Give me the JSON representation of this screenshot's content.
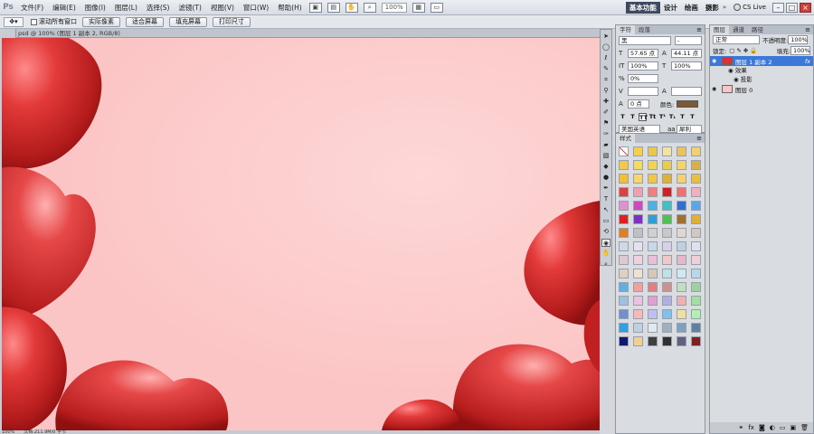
{
  "app": {
    "logo": "Ps"
  },
  "menu": [
    "文件(F)",
    "编辑(E)",
    "图像(I)",
    "图层(L)",
    "选择(S)",
    "滤镜(T)",
    "视图(V)",
    "窗口(W)",
    "帮助(H)"
  ],
  "appbar": {
    "zoom": "100%"
  },
  "workspaces": {
    "active": "基本功能",
    "items": [
      "设计",
      "绘画",
      "摄影"
    ],
    "more": "»"
  },
  "cs_live": "CS Live",
  "options": {
    "scroll_all_label": "滚动所有窗口",
    "buttons": [
      "实际像素",
      "适合屏幕",
      "填充屏幕",
      "打印尺寸"
    ]
  },
  "document": {
    "tab_title": "psd @ 100% (图层 1 副本 2, RGB/8)",
    "status_zoom": "100%",
    "status_doc": "文档:211.9M/0 字节"
  },
  "character_panel": {
    "tabs": [
      "字符",
      "段落"
    ],
    "font_family": "黑",
    "font_style": "-",
    "font_size": "57.65 点",
    "leading": "44.11 点",
    "vertical_scale": "100%",
    "horizontal_scale": "100%",
    "tracking": "0%",
    "baseline_shift": "0 点",
    "color_label": "颜色:",
    "language": "美国英语",
    "antialias": "犀利",
    "style_buttons": [
      "T",
      "T",
      "TT",
      "Tt",
      "T¹",
      "T₁",
      "T",
      "T"
    ],
    "text_color": "#7b5a35"
  },
  "styles_panel": {
    "tab": "样式",
    "swatches": [
      "#ffffff",
      "#f4d04a",
      "#e8c84a",
      "#efe4a0",
      "#e8c45a",
      "#f0d070",
      "#f3c84a",
      "#f1dc60",
      "#f0d458",
      "#e9cc4e",
      "#f2d46a",
      "#d8b048",
      "#f3c030",
      "#f7d66a",
      "#f2c640",
      "#e0b030",
      "#f4d070",
      "#e8c040",
      "#e04040",
      "#f0a0b0",
      "#f08080",
      "#d02020",
      "#f07070",
      "#f0b0c0",
      "#e090d0",
      "#d048c0",
      "#50b0e0",
      "#40c0c0",
      "#3070d0",
      "#58a8e8",
      "#e02020",
      "#8030c0",
      "#30a0d0",
      "#50c050",
      "#a07030",
      "#e0b030",
      "#e08020",
      "#c0c0c0",
      "#d0d0d0",
      "#c8c8c8",
      "#e0d8d0",
      "#d0c8c0",
      "#d0d8e8",
      "#e8e0f0",
      "#c8d8e8",
      "#d8d0e8",
      "#c0d0e0",
      "#e0e0f0",
      "#e0c8d0",
      "#f0d0e0",
      "#e8c0d8",
      "#f0c8c8",
      "#e8b8c8",
      "#f0d0d8",
      "#e0d0c0",
      "#f0e0d0",
      "#d8c8b8",
      "#c0e0e8",
      "#d0e8f0",
      "#b8d8e8",
      "#60b0e0",
      "#f0a0a0",
      "#e08080",
      "#d09090",
      "#c0e0c0",
      "#a0d0a0",
      "#a0c0e0",
      "#f0c0e0",
      "#e0a0d0",
      "#b0b0e0",
      "#f0b0b0",
      "#a0e0a0",
      "#7090d0",
      "#f8b8b8",
      "#c0c0f0",
      "#80c0f0",
      "#f0e0a0",
      "#b0f0b0",
      "#30a0e0",
      "#c0d0e0",
      "#e0e8f0",
      "#a0b0c0",
      "#80a0c0",
      "#6080a0",
      "#101870",
      "#f0d090",
      "#404040",
      "#303030",
      "#606080",
      "#802020"
    ]
  },
  "layers_panel": {
    "tabs": [
      "图层",
      "通道",
      "路径"
    ],
    "blend_mode": "正常",
    "opacity_label": "不透明度:",
    "opacity": "100%",
    "lock_label": "锁定:",
    "fill_label": "填充:",
    "fill": "100%",
    "layers": [
      {
        "name": "图层 1 副本 2",
        "selected": true,
        "fx": "fx"
      },
      {
        "name": "效果",
        "sub": true
      },
      {
        "name": "投影",
        "sub": true
      },
      {
        "name": "图层 0",
        "selected": false
      }
    ]
  }
}
